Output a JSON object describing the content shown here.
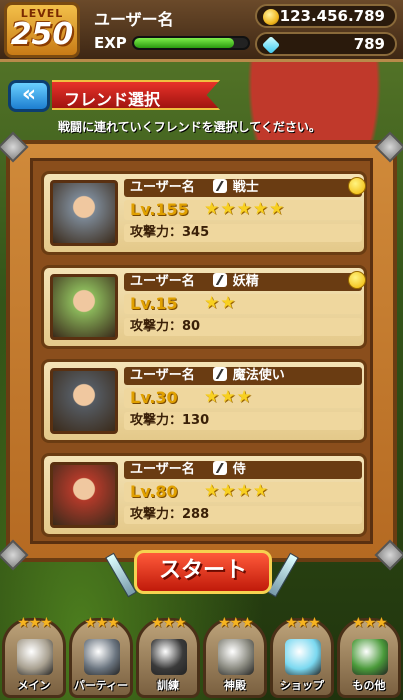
{
  "header": {
    "level_label": "LEVEL",
    "level": "250",
    "username": "ユーザー名",
    "exp_label": "EXP",
    "exp_progress": 0.88,
    "coins": "123.456.789",
    "gems": "789"
  },
  "title": {
    "back_icon": "double-chevron-left-icon",
    "label": "フレンド選択",
    "subtitle": "戦闘に連れていくフレンドを選択してください。"
  },
  "friends": [
    {
      "name": "ユーザー名",
      "class": "戦士",
      "class_icon": "sword-icon",
      "level": "Lv.155",
      "stars": 5,
      "attack": "攻撃力：345",
      "smile": true,
      "avatar_color": "#7b8794"
    },
    {
      "name": "ユーザー名",
      "class": "妖精",
      "class_icon": "shield-icon",
      "level": "Lv.15",
      "stars": 2,
      "attack": "攻撃力：80",
      "smile": true,
      "avatar_color": "#8ab65a"
    },
    {
      "name": "ユーザー名",
      "class": "魔法使い",
      "class_icon": "bow-icon",
      "level": "Lv.30",
      "stars": 3,
      "attack": "攻撃力：130",
      "smile": false,
      "avatar_color": "#555b62"
    },
    {
      "name": "ユーザー名",
      "class": "侍",
      "class_icon": "sword-icon",
      "level": "Lv.80",
      "stars": 4,
      "attack": "攻撃力：288",
      "smile": false,
      "avatar_color": "#b23a2a"
    }
  ],
  "start_label": "スタート",
  "nav": [
    {
      "label": "メイン",
      "icon": "castle-icon",
      "color": "#a8a090"
    },
    {
      "label": "パーティー",
      "icon": "party-knight-icon",
      "color": "#6b7580"
    },
    {
      "label": "訓練",
      "icon": "dumbbell-icon",
      "color": "#3a3a3a"
    },
    {
      "label": "神殿",
      "icon": "statue-icon",
      "color": "#8a8a80"
    },
    {
      "label": "ショップ",
      "icon": "diamond-icon",
      "color": "#7ad8f0"
    },
    {
      "label": "もの他",
      "icon": "island-icon",
      "color": "#4a9a3a"
    }
  ]
}
